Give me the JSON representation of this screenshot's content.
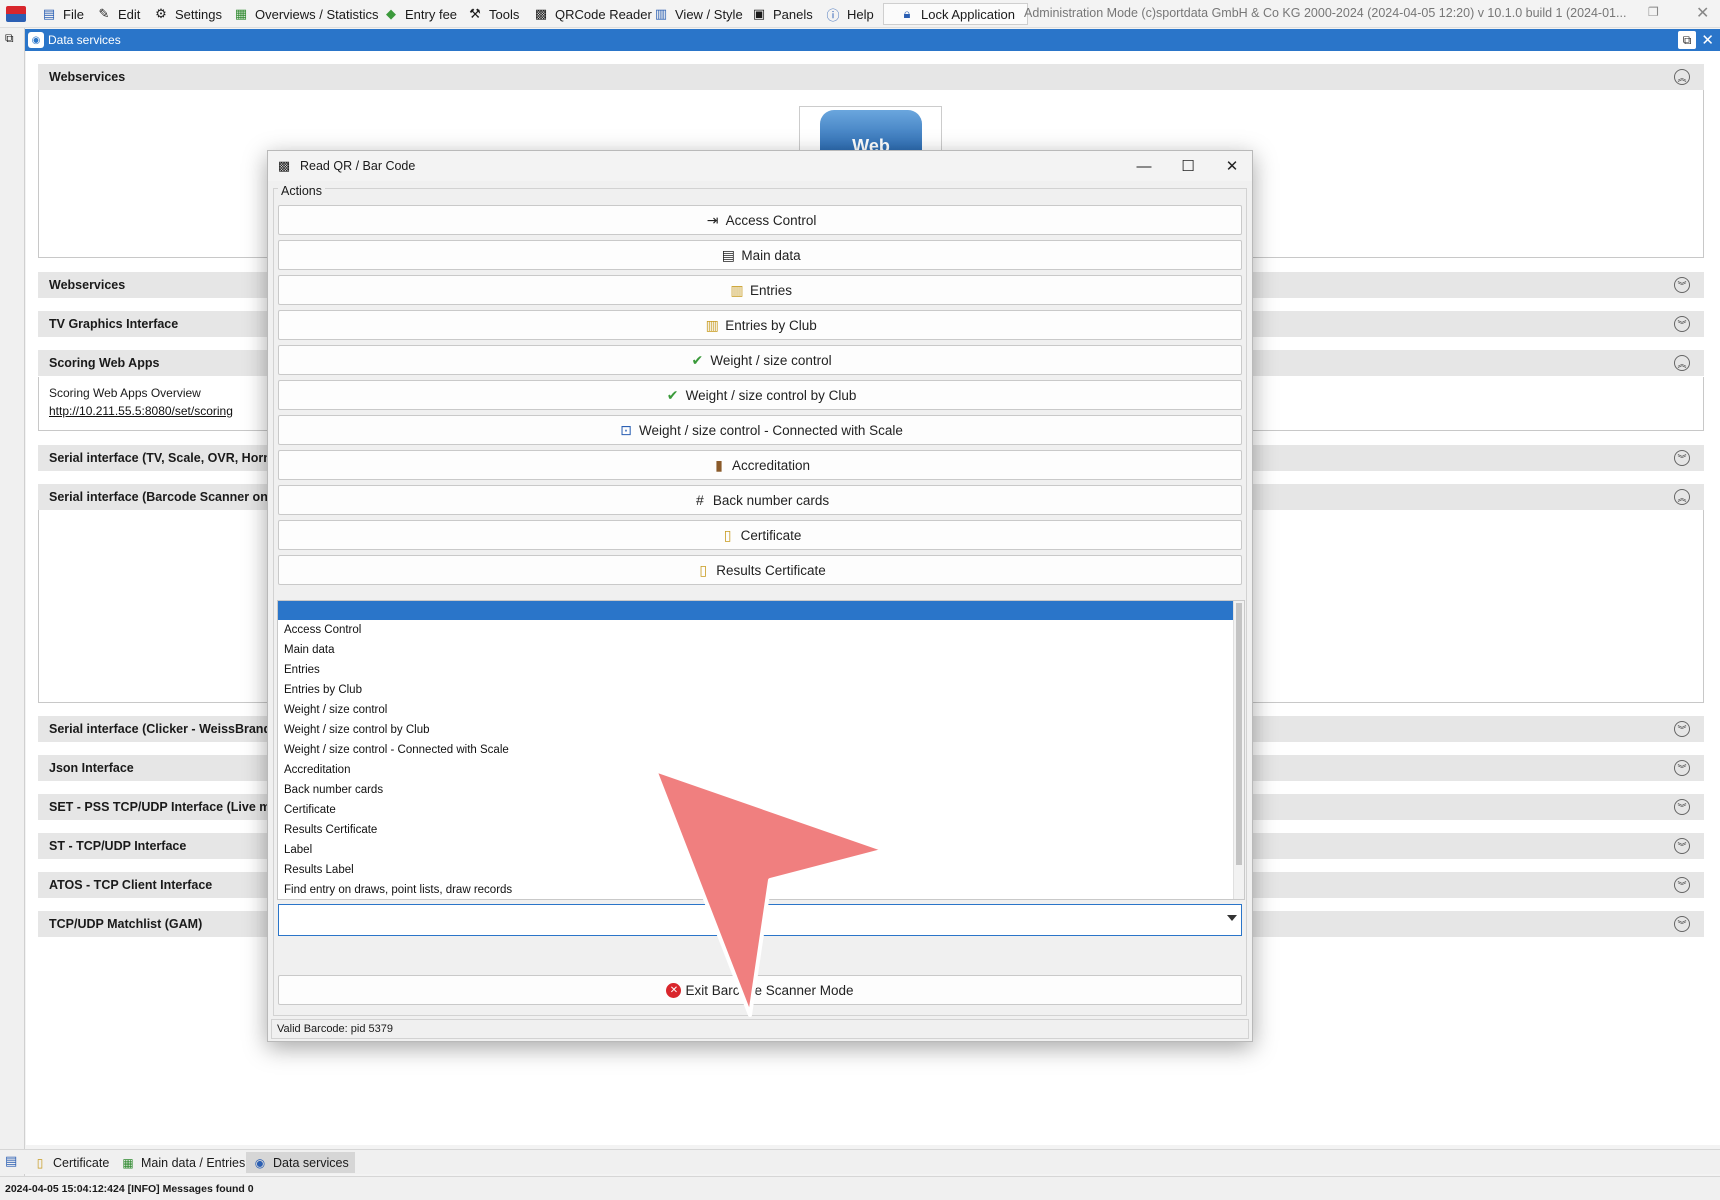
{
  "menubar": {
    "items": [
      {
        "label": "File",
        "icon": "file-icon"
      },
      {
        "label": "Edit",
        "icon": "edit-icon"
      },
      {
        "label": "Settings",
        "icon": "gear-icon"
      },
      {
        "label": "Overviews / Statistics",
        "icon": "overview-icon"
      },
      {
        "label": "Entry fee",
        "icon": "money-icon"
      },
      {
        "label": "Tools",
        "icon": "wrench-icon"
      },
      {
        "label": "QRCode Reader",
        "icon": "qrcode-icon"
      },
      {
        "label": "View / Style",
        "icon": "view-icon"
      },
      {
        "label": "Panels",
        "icon": "panels-icon"
      },
      {
        "label": "Help",
        "icon": "help-icon"
      }
    ],
    "lock_label": "Lock Application",
    "admin_info": "Administration Mode (c)sportdata GmbH & Co KG 2000-2024 (2024-04-05 12:20)  v 10.1.0 build 1 (2024-01..."
  },
  "module": {
    "title": "Data services",
    "sections": [
      {
        "label": "Webservices",
        "state": "expanded"
      },
      {
        "label": "Webservices",
        "state": "collapsed"
      },
      {
        "label": "TV Graphics Interface",
        "state": "collapsed"
      },
      {
        "label": "Scoring Web Apps",
        "state": "expanded"
      },
      {
        "label": "Serial interface (TV, Scale, OVR, Horn)",
        "state": "collapsed"
      },
      {
        "label": "Serial interface (Barcode Scanner only)",
        "state": "expanded"
      },
      {
        "label": "Serial interface (Clicker - WeissBrand)",
        "state": "collapsed"
      },
      {
        "label": "Json Interface",
        "state": "collapsed"
      },
      {
        "label": "SET - PSS TCP/UDP Interface (Live mat",
        "state": "collapsed"
      },
      {
        "label": "ST - TCP/UDP Interface",
        "state": "collapsed"
      },
      {
        "label": "ATOS - TCP Client Interface",
        "state": "collapsed"
      },
      {
        "label": "TCP/UDP Matchlist (GAM)",
        "state": "collapsed"
      }
    ],
    "web_tile_label": "Web",
    "scoring_overview_label": "Scoring Web Apps Overview",
    "scoring_link": "http://10.211.55.5:8080/set/scoring"
  },
  "dialog": {
    "title": "Read QR / Bar Code",
    "group_label": "Actions",
    "actions": [
      {
        "label": "Access Control",
        "icon": "access-control-icon"
      },
      {
        "label": "Main data",
        "icon": "id-card-icon"
      },
      {
        "label": "Entries",
        "icon": "entries-icon"
      },
      {
        "label": "Entries by Club",
        "icon": "entries-club-icon"
      },
      {
        "label": "Weight / size control",
        "icon": "check-icon"
      },
      {
        "label": "Weight / size control by Club",
        "icon": "check-icon"
      },
      {
        "label": "Weight / size control - Connected with Scale",
        "icon": "scale-icon"
      },
      {
        "label": "Accreditation",
        "icon": "accreditation-icon"
      },
      {
        "label": "Back number cards",
        "icon": "back-number-icon"
      },
      {
        "label": "Certificate",
        "icon": "certificate-icon"
      },
      {
        "label": "Results Certificate",
        "icon": "certificate-icon"
      }
    ],
    "dropdown_options": [
      "Access Control",
      "Main data",
      "Entries",
      "Entries by Club",
      "Weight / size control",
      "Weight / size control by Club",
      "Weight / size control - Connected with Scale",
      "Accreditation",
      "Back number cards",
      "Certificate",
      "Results Certificate",
      "Label",
      "Results Label",
      "Find entry on draws, point lists, draw records"
    ],
    "combo_value": "",
    "exit_label": "Exit Barcode Scanner Mode",
    "status": "Valid Barcode: pid 5379"
  },
  "bottom_tabs": [
    {
      "label": "Certificate",
      "icon": "certificate-icon"
    },
    {
      "label": "Main data / Entries",
      "icon": "main-data-icon"
    },
    {
      "label": "Data services",
      "icon": "data-services-icon"
    }
  ],
  "status_bar": "2024-04-05 15:04:12:424 [INFO] Messages found 0",
  "colors": {
    "accent": "#2a75c9",
    "cursor": "#f07f7f",
    "exit": "#d9262c"
  }
}
